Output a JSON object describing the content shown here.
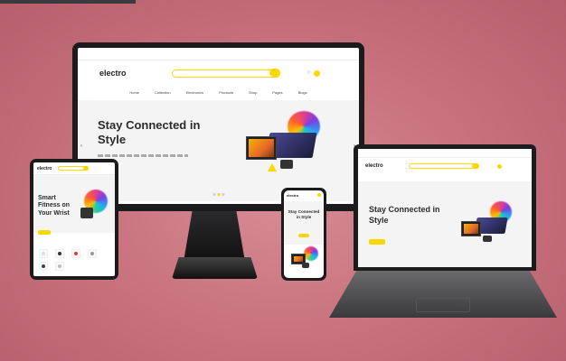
{
  "brand": {
    "logo": "electro",
    "accent": "#fed700"
  },
  "monitor": {
    "hero_title": "Stay Connected in Style",
    "nav": [
      "Home",
      "Collection",
      "Electronics",
      "Products",
      "Shop",
      "Pages",
      "Blogs"
    ]
  },
  "laptop": {
    "hero_title": "Stay Connected in Style"
  },
  "phone": {
    "hero_title": "Stay Connected in Style"
  },
  "tablet": {
    "hero_title": "Smart Fitness on Your Wrist"
  },
  "icons": [
    "search-icon",
    "heart-icon",
    "cart-icon",
    "arrow-left-icon",
    "arrow-right-icon"
  ]
}
